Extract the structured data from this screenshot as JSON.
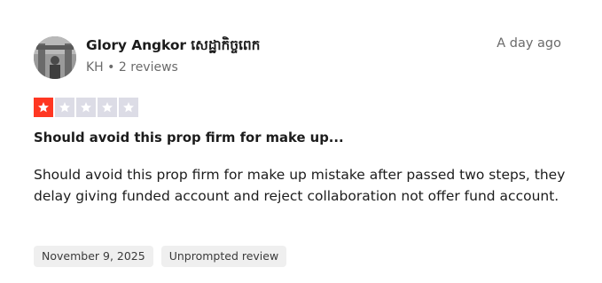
{
  "reviewer": {
    "name": "Glory Angkor សេដ្ឋាកិច្ចពេក",
    "country": "KH",
    "separator": "•",
    "reviews": "2 reviews"
  },
  "date_ago": "A day ago",
  "rating": {
    "value": 1,
    "max": 5,
    "colors": {
      "filled": "#ff3722",
      "empty": "#dcdce6"
    },
    "icon": "star-icon"
  },
  "review": {
    "title": "Should avoid this prop firm for make up...",
    "body": "Should avoid this prop firm for make up mistake after passed two steps, they delay giving funded account and reject collaboration not offer fund account."
  },
  "tags": {
    "date": "November 9, 2025",
    "type": "Unprompted review"
  }
}
